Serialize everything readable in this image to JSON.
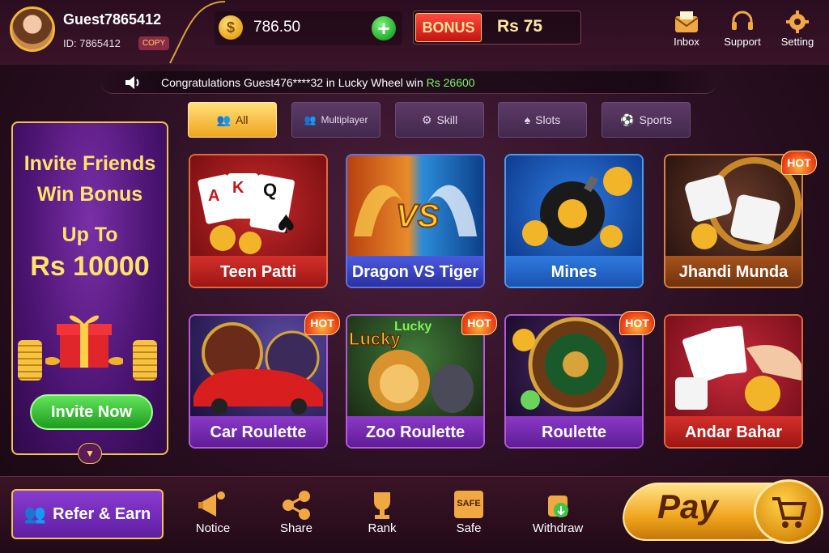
{
  "user": {
    "name": "Guest7865412",
    "id_label": "ID: 7865412",
    "copy_label": "COPY"
  },
  "wallet": {
    "balance": "786.50",
    "bonus_tag": "BONUS",
    "bonus_value": "Rs 75"
  },
  "top_nav": [
    {
      "label": "Inbox",
      "icon": "inbox-icon"
    },
    {
      "label": "Support",
      "icon": "headset-icon"
    },
    {
      "label": "Setting",
      "icon": "gear-icon"
    }
  ],
  "marquee": {
    "text": "Congratulations Guest476****32 in Lucky Wheel win",
    "amount": "Rs 26600"
  },
  "tabs": [
    {
      "label": "All",
      "active": true,
      "icon": "users-icon"
    },
    {
      "label": "Multiplayer",
      "active": false,
      "icon": "multiplayer-icon"
    },
    {
      "label": "Skill",
      "active": false,
      "icon": "skill-icon"
    },
    {
      "label": "Slots",
      "active": false,
      "icon": "slots-icon"
    },
    {
      "label": "Sports",
      "active": false,
      "icon": "sports-icon"
    }
  ],
  "invite": {
    "line1": "Invite Friends",
    "line2": "Win Bonus",
    "line3": "Up To",
    "line4": "Rs 10000",
    "button": "Invite Now"
  },
  "games": [
    {
      "name": "Teen Patti",
      "hot": false,
      "hot_label": ""
    },
    {
      "name": "Dragon VS Tiger",
      "hot": false,
      "hot_label": ""
    },
    {
      "name": "Mines",
      "hot": false,
      "hot_label": ""
    },
    {
      "name": "Jhandi Munda",
      "hot": true,
      "hot_label": "HOT"
    },
    {
      "name": "Car Roulette",
      "hot": true,
      "hot_label": "HOT"
    },
    {
      "name": "Zoo Roulette",
      "hot": true,
      "hot_label": "HOT"
    },
    {
      "name": "Roulette",
      "hot": true,
      "hot_label": "HOT"
    },
    {
      "name": "Andar Bahar",
      "hot": false,
      "hot_label": ""
    }
  ],
  "game_art_labels": {
    "teen_patti_cards": [
      "A",
      "K",
      "Q"
    ],
    "dragon_vs": "VS",
    "zoo_lucky": "Lucky"
  },
  "bottom_nav": {
    "refer_label": "Refer & Earn",
    "items": [
      {
        "label": "Notice",
        "icon": "megaphone-icon"
      },
      {
        "label": "Share",
        "icon": "share-icon"
      },
      {
        "label": "Rank",
        "icon": "trophy-icon"
      },
      {
        "label": "Safe",
        "icon": "safe-icon"
      },
      {
        "label": "Withdraw",
        "icon": "withdraw-icon"
      }
    ],
    "safe_badge": "SAFE",
    "pay_label": "Pay"
  }
}
